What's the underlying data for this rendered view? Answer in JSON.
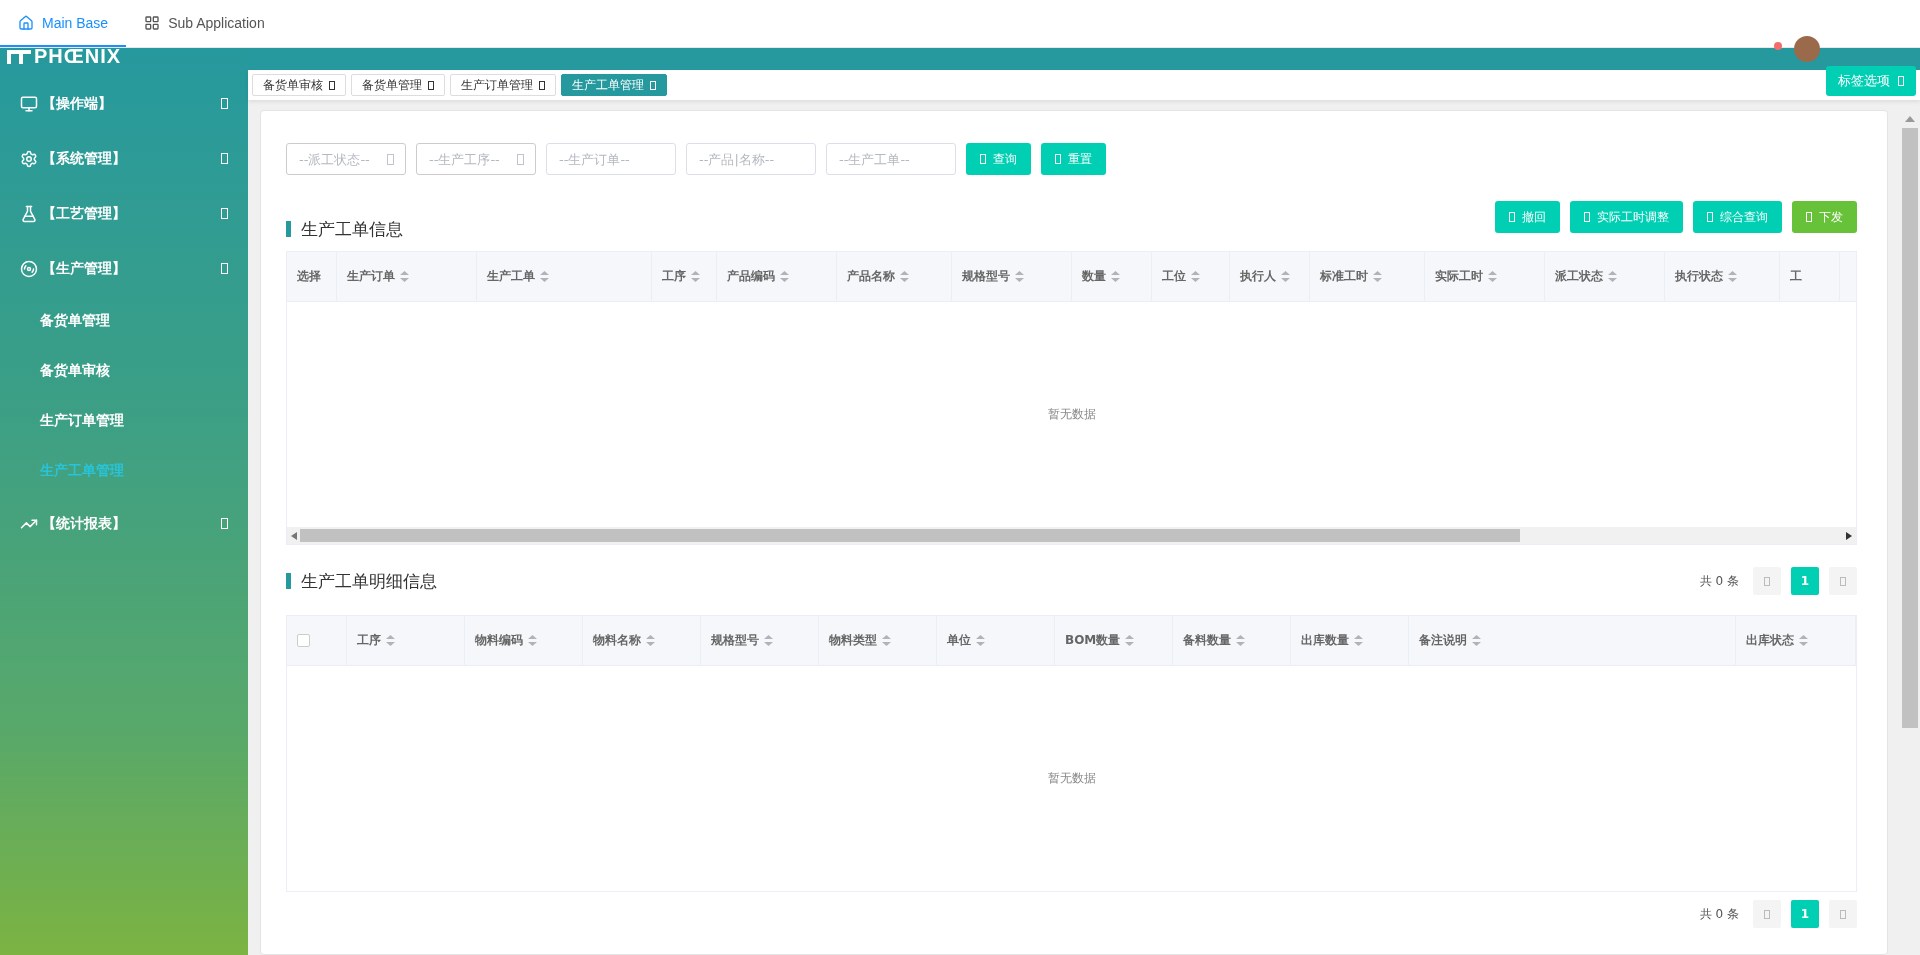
{
  "app_tabs": [
    {
      "label": "Main Base",
      "selected": true
    },
    {
      "label": "Sub Application",
      "selected": false
    }
  ],
  "logo": {
    "text": "PHŒNIX"
  },
  "sidebar": {
    "items": [
      {
        "label": "【操作端】"
      },
      {
        "label": "【系统管理】"
      },
      {
        "label": "【工艺管理】"
      },
      {
        "label": "【生产管理】",
        "children": [
          {
            "label": "备货单管理",
            "selected": false
          },
          {
            "label": "备货单审核",
            "selected": false
          },
          {
            "label": "生产订单管理",
            "selected": false
          },
          {
            "label": "生产工单管理",
            "selected": true
          }
        ]
      },
      {
        "label": "【统计报表】"
      }
    ]
  },
  "page_tabs": [
    {
      "label": "备货单审核",
      "selected": false
    },
    {
      "label": "备货单管理",
      "selected": false
    },
    {
      "label": "生产订单管理",
      "selected": false
    },
    {
      "label": "生产工单管理",
      "selected": true
    }
  ],
  "tab_options_button": "标签选项",
  "filters": [
    {
      "kind": "select",
      "placeholder": "--派工状态--"
    },
    {
      "kind": "select",
      "placeholder": "--生产工序--"
    },
    {
      "kind": "input",
      "placeholder": "--生产订单--"
    },
    {
      "kind": "input",
      "placeholder": "--产品|名称--"
    },
    {
      "kind": "input",
      "placeholder": "--生产工单--"
    }
  ],
  "filter_buttons": [
    "查询",
    "重置"
  ],
  "work_orders": {
    "title": "生产工单信息",
    "actions": [
      {
        "label": "撤回",
        "kind": "primary"
      },
      {
        "label": "实际工时调整",
        "kind": "primary"
      },
      {
        "label": "综合查询",
        "kind": "primary"
      },
      {
        "label": "下发",
        "kind": "success"
      }
    ],
    "columns": [
      "选择",
      "生产订单",
      "生产工单",
      "工序",
      "产品编码",
      "产品名称",
      "规格型号",
      "数量",
      "工位",
      "执行人",
      "标准工时",
      "实际工时",
      "派工状态",
      "执行状态",
      "工"
    ],
    "empty_text": "暂无数据"
  },
  "details": {
    "title": "生产工单明细信息",
    "pagination": {
      "total": "共 0 条",
      "pages": [
        {
          "label": "1",
          "selected": true
        }
      ]
    },
    "select_all": {
      "checked": false
    },
    "columns": [
      "工序",
      "物料编码",
      "物料名称",
      "规格型号",
      "物料类型",
      "单位",
      "BOM数量",
      "备料数量",
      "出库数量",
      "备注说明",
      "出库状态"
    ],
    "empty_text": "暂无数据",
    "bottom_pagination": {
      "total": "共 0 条",
      "pages": [
        {
          "label": "1",
          "selected": true
        }
      ]
    }
  }
}
